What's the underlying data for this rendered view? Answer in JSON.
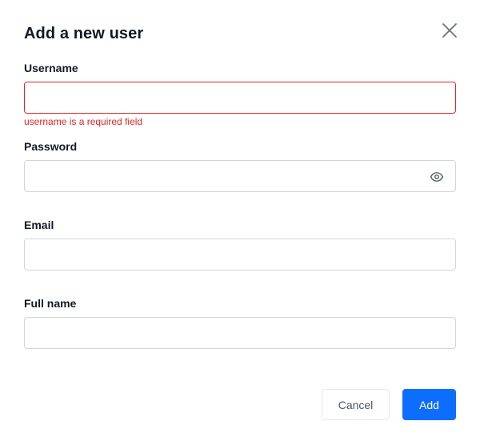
{
  "dialog": {
    "title": "Add a new user",
    "close_icon": "close-icon"
  },
  "fields": {
    "username": {
      "label": "Username",
      "value": "",
      "error": "username is a required field",
      "status_color": "#dc2626"
    },
    "password": {
      "label": "Password",
      "value": "",
      "toggle_icon": "eye-icon"
    },
    "email": {
      "label": "Email",
      "value": ""
    },
    "full_name": {
      "label": "Full name",
      "value": ""
    }
  },
  "actions": {
    "cancel_label": "Cancel",
    "add_label": "Add",
    "accent_color": "#0d6efd"
  }
}
